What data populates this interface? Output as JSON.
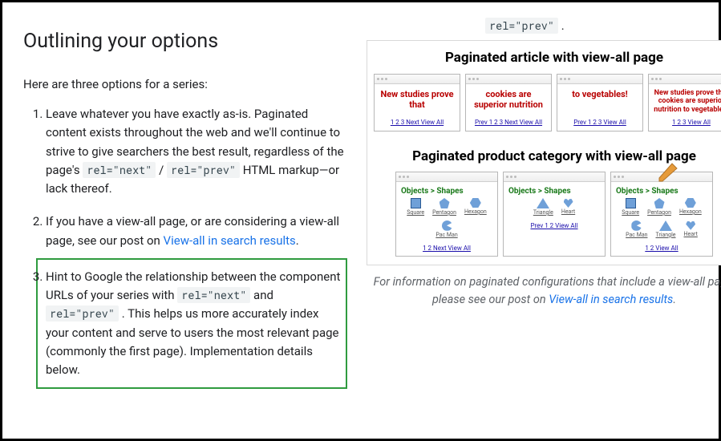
{
  "top_code": "rel=\"prev\"",
  "top_code_trail": " .",
  "heading": "Outlining your options",
  "intro": "Here are three options for a series:",
  "items": {
    "i1": {
      "t1": "Leave whatever you have exactly as-is. Paginated content exists throughout the web and we'll continue to strive to give searchers the best result, regardless of the page's ",
      "c1": "rel=\"next\"",
      "sep": " / ",
      "c2": "rel=\"prev\"",
      "t2": " HTML markup—or lack thereof."
    },
    "i2": {
      "t1": "If you have a view-all page, or are considering a view-all page, see our post on ",
      "link": "View-all in search results",
      "t2": "."
    },
    "i3": {
      "t1": "Hint to Google the relationship between the component URLs of your series with ",
      "c1": "rel=\"next\"",
      "mid": " and ",
      "c2": "rel=\"prev\"",
      "t2": " . This helps us more accurately index your content and serve to users the most relevant page (commonly the first page). Implementation details below."
    }
  },
  "fig1": {
    "title": "Paginated article with view-all page",
    "p1": {
      "head": "New studies prove that",
      "nav": "1 2 3 Next View All"
    },
    "p2": {
      "head": "cookies are superior nutrition",
      "nav": "Prev 1 2 3 Next View All"
    },
    "p3": {
      "head": "to vegetables!",
      "nav": "Prev 1 2 3 View All"
    },
    "p4": {
      "head": "New studies prove that cookies are superior nutrition to vegetables!",
      "nav": "1 2 3 View All"
    }
  },
  "fig2": {
    "title": "Paginated product category with view-all page",
    "p1": {
      "head": "Objects > Shapes",
      "nav": "1 2 Next View All",
      "shapes": [
        "Square",
        "Pentagon",
        "Hexagon",
        "Pac Man"
      ]
    },
    "p2": {
      "head": "Objects > Shapes",
      "nav": "Prev 1 2 View All",
      "shapes": [
        "Triangle",
        "Heart"
      ]
    },
    "p3": {
      "head": "Objects > Shapes",
      "nav": "1 2 View All",
      "shapes": [
        "Square",
        "Pentagon",
        "Hexagon",
        "Pac Man",
        "Triangle",
        "Heart"
      ]
    }
  },
  "caption": {
    "t1": "For information on paginated configurations that include a view-all page, please see our post on ",
    "link": "View-all in search results",
    "t2": "."
  }
}
